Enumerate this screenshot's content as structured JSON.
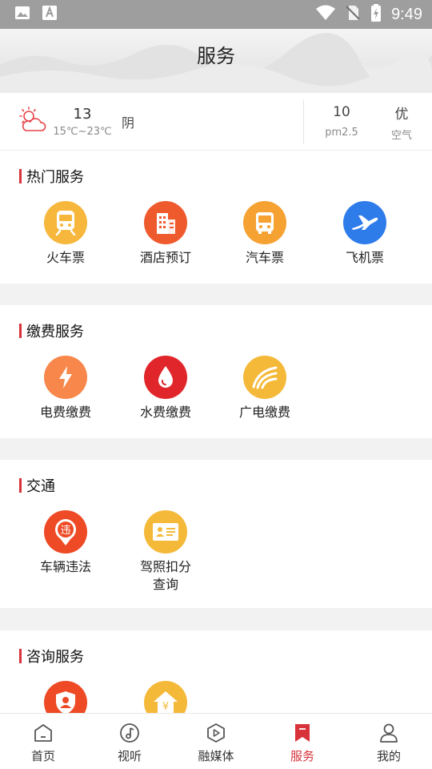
{
  "status_bar": {
    "time": "9:49"
  },
  "header": {
    "title": "服务"
  },
  "weather": {
    "temperature": "13",
    "range": "15℃~23℃",
    "condition": "阴",
    "pm_value": "10",
    "pm_label": "pm2.5",
    "air_value": "优",
    "air_label": "空气"
  },
  "sections": [
    {
      "title": "热门服务",
      "items": [
        {
          "label": "火车票",
          "icon": "train-icon",
          "color": "#f6b73c"
        },
        {
          "label": "酒店预订",
          "icon": "hotel-icon",
          "color": "#ef5a2d"
        },
        {
          "label": "汽车票",
          "icon": "bus-icon",
          "color": "#f5a233"
        },
        {
          "label": "飞机票",
          "icon": "airplane-icon",
          "color": "#2e7bea"
        }
      ]
    },
    {
      "title": "缴费服务",
      "items": [
        {
          "label": "电费缴费",
          "icon": "lightning-icon",
          "color": "#f7874a"
        },
        {
          "label": "水费缴费",
          "icon": "water-drop-icon",
          "color": "#e0262b"
        },
        {
          "label": "广电缴费",
          "icon": "broadcast-icon",
          "color": "#f5b93a"
        }
      ]
    },
    {
      "title": "交通",
      "items": [
        {
          "label": "车辆违法",
          "icon": "violation-pin-icon",
          "color": "#ee4a25"
        },
        {
          "label_line1": "驾照扣分",
          "label_line2": "查询",
          "icon": "license-card-icon",
          "color": "#f5b93a"
        }
      ]
    },
    {
      "title": "咨询服务",
      "items": [
        {
          "icon": "shield-user-icon",
          "color": "#ee4a25"
        },
        {
          "icon": "house-yuan-icon",
          "color": "#f5b93a"
        }
      ]
    }
  ],
  "tabs": [
    {
      "label": "首页",
      "icon": "home-icon"
    },
    {
      "label": "视听",
      "icon": "music-note-icon"
    },
    {
      "label": "融媒体",
      "icon": "play-hexagon-icon"
    },
    {
      "label": "服务",
      "icon": "bookmark-icon",
      "active": true
    },
    {
      "label": "我的",
      "icon": "user-icon"
    }
  ],
  "colors": {
    "accent": "#d8323a",
    "status_bar": "#9e9e9e"
  }
}
